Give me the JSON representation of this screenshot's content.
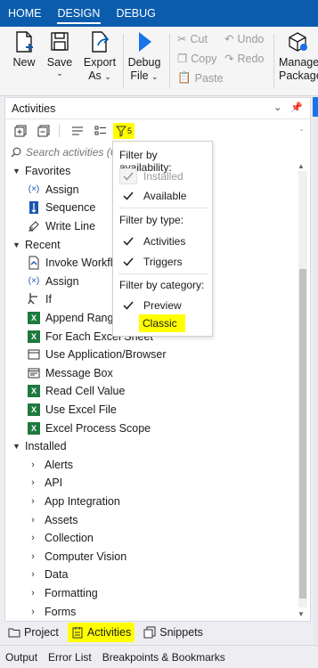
{
  "menu": {
    "tabs": [
      "HOME",
      "DESIGN",
      "DEBUG"
    ],
    "active_tab": "DESIGN"
  },
  "ribbon": {
    "new": "New",
    "save": "Save",
    "export_line1": "Export",
    "export_line2": "As",
    "debug_line1": "Debug",
    "debug_line2": "File",
    "cut": "Cut",
    "undo": "Undo",
    "copy": "Copy",
    "redo": "Redo",
    "paste": "Paste",
    "manage_line1": "Manage",
    "manage_line2": "Packages"
  },
  "panel": {
    "title": "Activities",
    "filter_badge": "5",
    "search_placeholder": "Search activities (Ctrl+Alt+F)"
  },
  "tree": {
    "favorites": {
      "label": "Favorites",
      "items": [
        "Assign",
        "Sequence",
        "Write Line"
      ]
    },
    "recent": {
      "label": "Recent",
      "items": [
        "Invoke Workflow File",
        "Assign",
        "If",
        "Append Range",
        "For Each Excel Sheet",
        "Use Application/Browser",
        "Message Box",
        "Read Cell Value",
        "Use Excel File",
        "Excel Process Scope"
      ]
    },
    "installed": {
      "label": "Installed",
      "items": [
        "Alerts",
        "API",
        "App Integration",
        "Assets",
        "Collection",
        "Computer Vision",
        "Data",
        "Formatting",
        "Forms"
      ]
    }
  },
  "filter": {
    "availability_label": "Filter by availability:",
    "installed": "Installed",
    "available": "Available",
    "type_label": "Filter by type:",
    "activities": "Activities",
    "triggers": "Triggers",
    "category_label": "Filter by category:",
    "preview": "Preview",
    "classic": "Classic",
    "checked": {
      "installed": true,
      "available": true,
      "activities": true,
      "triggers": true,
      "preview": true
    }
  },
  "bottom_tabs": [
    "Project",
    "Activities",
    "Snippets"
  ],
  "status_tabs": [
    "Output",
    "Error List",
    "Breakpoints & Bookmarks"
  ],
  "colors": {
    "menubar": "#0b5cad",
    "highlight": "#ffff00",
    "excel": "#1d7a3e",
    "accent": "#1a73e8"
  }
}
